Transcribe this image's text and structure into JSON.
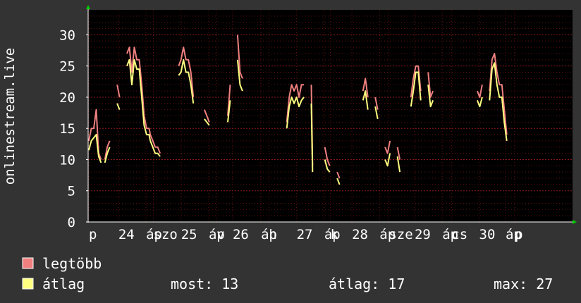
{
  "colors": {
    "background": "#333333",
    "plot_background": "#000000",
    "grid": "#8b1a1a",
    "axis": "#ffffff",
    "max_series": "#f08080",
    "avg_series": "#ffff80",
    "arrow": "#00cc00"
  },
  "chart_data": {
    "type": "line",
    "ylabel": "onlinestream.live",
    "ylim": [
      0,
      34
    ],
    "yticks": [
      0,
      5,
      10,
      15,
      20,
      25,
      30
    ],
    "xlim": [
      0,
      787
    ],
    "xtick_labels": [
      {
        "x": 0,
        "label": "p"
      },
      {
        "x": 48,
        "label": "24"
      },
      {
        "x": 93,
        "label": "áp"
      },
      {
        "x": 105,
        "label": "szo"
      },
      {
        "x": 150,
        "label": "25"
      },
      {
        "x": 195,
        "label": "áp"
      },
      {
        "x": 208,
        "label": "v"
      },
      {
        "x": 234,
        "label": "26"
      },
      {
        "x": 280,
        "label": "áp"
      },
      {
        "x": 293,
        "label": "h"
      },
      {
        "x": 338,
        "label": "27"
      },
      {
        "x": 383,
        "label": "áp"
      },
      {
        "x": 393,
        "label": "k"
      },
      {
        "x": 428,
        "label": "28"
      },
      {
        "x": 473,
        "label": "áp"
      },
      {
        "x": 488,
        "label": "sze"
      },
      {
        "x": 530,
        "label": "29"
      },
      {
        "x": 575,
        "label": "áp"
      },
      {
        "x": 590,
        "label": "cs"
      },
      {
        "x": 635,
        "label": "30"
      },
      {
        "x": 678,
        "label": "áp"
      },
      {
        "x": 693,
        "label": "p"
      }
    ],
    "series": [
      {
        "name": "legtöbb",
        "points": [
          [
            0,
            13
          ],
          [
            4,
            15
          ],
          [
            8,
            15
          ],
          [
            12,
            18
          ],
          [
            16,
            11
          ],
          [
            20,
            10
          ],
          [
            26,
            10
          ],
          [
            30,
            12
          ],
          [
            34,
            13
          ],
          [
            40,
            17
          ],
          [
            46,
            22
          ],
          [
            50,
            20
          ],
          [
            56,
            24
          ],
          [
            62,
            27
          ],
          [
            66,
            28
          ],
          [
            70,
            24
          ],
          [
            74,
            28
          ],
          [
            78,
            26
          ],
          [
            82,
            26
          ],
          [
            86,
            22
          ],
          [
            90,
            17
          ],
          [
            94,
            15
          ],
          [
            98,
            15
          ],
          [
            100,
            14
          ],
          [
            104,
            13
          ],
          [
            108,
            12
          ],
          [
            112,
            12
          ],
          [
            116,
            11
          ],
          [
            122,
            14
          ],
          [
            128,
            16
          ],
          [
            134,
            22
          ],
          [
            140,
            23
          ],
          [
            146,
            25
          ],
          [
            150,
            26
          ],
          [
            154,
            28
          ],
          [
            158,
            26
          ],
          [
            162,
            26
          ],
          [
            166,
            24
          ],
          [
            170,
            20
          ],
          [
            176,
            23
          ],
          [
            182,
            20
          ],
          [
            188,
            18
          ],
          [
            192,
            17
          ],
          [
            196,
            16
          ],
          [
            202,
            16
          ],
          [
            208,
            16
          ],
          [
            214,
            17
          ],
          [
            220,
            17
          ],
          [
            226,
            17
          ],
          [
            230,
            22
          ],
          [
            236,
            25
          ],
          [
            242,
            30
          ],
          [
            246,
            24
          ],
          [
            250,
            23
          ],
          [
            256,
            22
          ],
          [
            262,
            20
          ],
          [
            268,
            18
          ],
          [
            274,
            16
          ],
          [
            280,
            16
          ],
          [
            286,
            15
          ],
          [
            292,
            14
          ],
          [
            298,
            13
          ],
          [
            304,
            13
          ],
          [
            310,
            12
          ],
          [
            316,
            14
          ],
          [
            322,
            16
          ],
          [
            326,
            20
          ],
          [
            330,
            22
          ],
          [
            334,
            21
          ],
          [
            338,
            22
          ],
          [
            342,
            20
          ],
          [
            346,
            22
          ],
          [
            350,
            22
          ],
          [
            356,
            23
          ],
          [
            362,
            22
          ],
          [
            364,
            9
          ],
          [
            372,
            6
          ],
          [
            378,
            10
          ],
          [
            384,
            12
          ],
          [
            388,
            10
          ],
          [
            392,
            9
          ],
          [
            398,
            10
          ],
          [
            404,
            8
          ],
          [
            408,
            7
          ],
          [
            414,
            9
          ],
          [
            420,
            12
          ],
          [
            428,
            15
          ],
          [
            434,
            17
          ],
          [
            440,
            18
          ],
          [
            446,
            21
          ],
          [
            450,
            23
          ],
          [
            454,
            20
          ],
          [
            460,
            19
          ],
          [
            466,
            20
          ],
          [
            470,
            18
          ],
          [
            476,
            15
          ],
          [
            482,
            12
          ],
          [
            486,
            11
          ],
          [
            490,
            13
          ],
          [
            496,
            12
          ],
          [
            502,
            12
          ],
          [
            506,
            10
          ],
          [
            512,
            14
          ],
          [
            518,
            17
          ],
          [
            524,
            20
          ],
          [
            528,
            23
          ],
          [
            532,
            25
          ],
          [
            536,
            25
          ],
          [
            540,
            21
          ],
          [
            546,
            22
          ],
          [
            552,
            24
          ],
          [
            556,
            20
          ],
          [
            560,
            21
          ],
          [
            566,
            20
          ],
          [
            572,
            19
          ],
          [
            578,
            18
          ],
          [
            584,
            16
          ],
          [
            590,
            15
          ],
          [
            596,
            14
          ],
          [
            602,
            15
          ],
          [
            608,
            17
          ],
          [
            614,
            18
          ],
          [
            620,
            18
          ],
          [
            626,
            20
          ],
          [
            632,
            21
          ],
          [
            636,
            20
          ],
          [
            640,
            22
          ],
          [
            646,
            20
          ],
          [
            652,
            21
          ],
          [
            656,
            26
          ],
          [
            660,
            27
          ],
          [
            664,
            24
          ],
          [
            668,
            22
          ],
          [
            672,
            22
          ],
          [
            676,
            18
          ],
          [
            680,
            14
          ]
        ]
      },
      {
        "name": "átlag",
        "points": [
          [
            0,
            11.5
          ],
          [
            4,
            13
          ],
          [
            8,
            13.5
          ],
          [
            12,
            14
          ],
          [
            16,
            10.5
          ],
          [
            20,
            9.5
          ],
          [
            26,
            9.5
          ],
          [
            30,
            11
          ],
          [
            34,
            12
          ],
          [
            40,
            16
          ],
          [
            46,
            19
          ],
          [
            50,
            18
          ],
          [
            56,
            21
          ],
          [
            62,
            25
          ],
          [
            66,
            26
          ],
          [
            70,
            22
          ],
          [
            74,
            26
          ],
          [
            78,
            24.5
          ],
          [
            82,
            24.5
          ],
          [
            86,
            20
          ],
          [
            90,
            15.5
          ],
          [
            94,
            14
          ],
          [
            98,
            14
          ],
          [
            100,
            13
          ],
          [
            104,
            12
          ],
          [
            108,
            11
          ],
          [
            112,
            11
          ],
          [
            116,
            10.5
          ],
          [
            122,
            13
          ],
          [
            128,
            15
          ],
          [
            134,
            20
          ],
          [
            140,
            21.5
          ],
          [
            146,
            23.5
          ],
          [
            150,
            24
          ],
          [
            154,
            26
          ],
          [
            158,
            24
          ],
          [
            162,
            24
          ],
          [
            166,
            22
          ],
          [
            170,
            19
          ],
          [
            176,
            21
          ],
          [
            182,
            19
          ],
          [
            188,
            16.5
          ],
          [
            192,
            16
          ],
          [
            196,
            15.5
          ],
          [
            202,
            15.5
          ],
          [
            208,
            15
          ],
          [
            214,
            16
          ],
          [
            220,
            16
          ],
          [
            226,
            16
          ],
          [
            230,
            19.5
          ],
          [
            236,
            22
          ],
          [
            242,
            26
          ],
          [
            246,
            22
          ],
          [
            250,
            21
          ],
          [
            256,
            20
          ],
          [
            262,
            18.5
          ],
          [
            268,
            16.5
          ],
          [
            274,
            15
          ],
          [
            280,
            14.5
          ],
          [
            286,
            14
          ],
          [
            292,
            13
          ],
          [
            298,
            12
          ],
          [
            304,
            12
          ],
          [
            310,
            11
          ],
          [
            316,
            13
          ],
          [
            322,
            15
          ],
          [
            326,
            18.5
          ],
          [
            330,
            20
          ],
          [
            334,
            19
          ],
          [
            338,
            20
          ],
          [
            342,
            18.5
          ],
          [
            346,
            19.5
          ],
          [
            350,
            20
          ],
          [
            356,
            21
          ],
          [
            362,
            19
          ],
          [
            364,
            8
          ],
          [
            372,
            5
          ],
          [
            378,
            9
          ],
          [
            384,
            10
          ],
          [
            388,
            8.5
          ],
          [
            392,
            8
          ],
          [
            398,
            9
          ],
          [
            404,
            7
          ],
          [
            408,
            6
          ],
          [
            414,
            8
          ],
          [
            420,
            10.5
          ],
          [
            428,
            13.5
          ],
          [
            434,
            15.5
          ],
          [
            440,
            16.5
          ],
          [
            446,
            19.5
          ],
          [
            450,
            21
          ],
          [
            454,
            18
          ],
          [
            460,
            17.5
          ],
          [
            466,
            18.5
          ],
          [
            470,
            16.5
          ],
          [
            476,
            13.5
          ],
          [
            482,
            10
          ],
          [
            486,
            9
          ],
          [
            490,
            11
          ],
          [
            496,
            10
          ],
          [
            502,
            10.5
          ],
          [
            506,
            8
          ],
          [
            512,
            12.5
          ],
          [
            518,
            15.5
          ],
          [
            524,
            18.5
          ],
          [
            528,
            21
          ],
          [
            532,
            24
          ],
          [
            536,
            24
          ],
          [
            540,
            19.5
          ],
          [
            546,
            20
          ],
          [
            552,
            22
          ],
          [
            556,
            18.5
          ],
          [
            560,
            19.5
          ],
          [
            566,
            18
          ],
          [
            572,
            17.5
          ],
          [
            578,
            16.5
          ],
          [
            584,
            14.5
          ],
          [
            590,
            13.5
          ],
          [
            596,
            13
          ],
          [
            602,
            14
          ],
          [
            608,
            15.5
          ],
          [
            614,
            16.5
          ],
          [
            620,
            16.5
          ],
          [
            626,
            18.5
          ],
          [
            632,
            19.5
          ],
          [
            636,
            18.5
          ],
          [
            640,
            20
          ],
          [
            646,
            18.5
          ],
          [
            652,
            19.5
          ],
          [
            656,
            24.5
          ],
          [
            660,
            25.5
          ],
          [
            664,
            22
          ],
          [
            668,
            20
          ],
          [
            672,
            20
          ],
          [
            676,
            16
          ],
          [
            680,
            13
          ]
        ]
      }
    ]
  },
  "legend": {
    "max_label": "legtöbb",
    "avg_label": "átlag",
    "now_text": "most: 13",
    "avg_text": "átlag: 17",
    "max_text": "max: 27"
  }
}
